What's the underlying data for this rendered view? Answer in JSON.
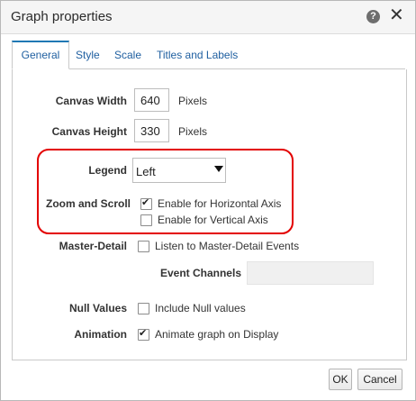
{
  "dialog": {
    "title": "Graph properties",
    "help_icon": "?",
    "close_icon": "✕"
  },
  "tabs": [
    {
      "label": "General",
      "active": true
    },
    {
      "label": "Style",
      "active": false
    },
    {
      "label": "Scale",
      "active": false
    },
    {
      "label": "Titles and Labels",
      "active": false
    }
  ],
  "general": {
    "canvas_width": {
      "label": "Canvas Width",
      "value": "640",
      "unit": "Pixels"
    },
    "canvas_height": {
      "label": "Canvas Height",
      "value": "330",
      "unit": "Pixels"
    },
    "legend": {
      "label": "Legend",
      "selected": "Left"
    },
    "zoom_scroll": {
      "label": "Zoom and Scroll",
      "horizontal": {
        "label": "Enable for Horizontal Axis",
        "checked": true
      },
      "vertical": {
        "label": "Enable for Vertical Axis",
        "checked": false
      }
    },
    "master_detail": {
      "label": "Master-Detail",
      "listen": {
        "label": "Listen to Master-Detail Events",
        "checked": false
      },
      "event_channels_label": "Event Channels",
      "event_channels_value": ""
    },
    "null_values": {
      "label": "Null Values",
      "include": {
        "label": "Include Null values",
        "checked": false
      }
    },
    "animation": {
      "label": "Animation",
      "animate": {
        "label": "Animate graph on Display",
        "checked": true
      }
    }
  },
  "footer": {
    "ok_label": "OK",
    "cancel_label": "Cancel"
  },
  "colors": {
    "highlight_box": "#e30000",
    "tab_accent": "#1f78b4",
    "link_text": "#1f5fa0"
  }
}
